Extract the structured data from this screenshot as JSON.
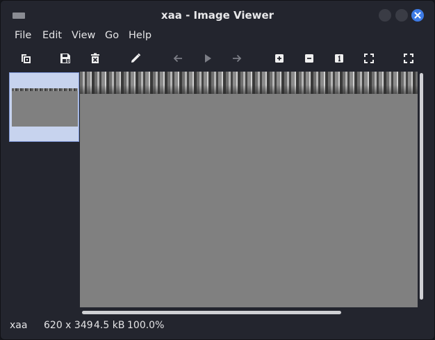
{
  "window": {
    "title": "xaa - Image Viewer",
    "accent_color": "#3d7be6",
    "window_menu_icon": "window-menu-icon",
    "controls": [
      "minimize-button",
      "maximize-button",
      "close-button"
    ]
  },
  "menubar": {
    "items": [
      {
        "label": "File"
      },
      {
        "label": "Edit"
      },
      {
        "label": "View"
      },
      {
        "label": "Go"
      },
      {
        "label": "Help"
      }
    ]
  },
  "toolbar": {
    "buttons": [
      {
        "icon": "open-file-icon",
        "enabled": true
      },
      {
        "icon": "save-icon",
        "enabled": true
      },
      {
        "icon": "delete-icon",
        "enabled": true
      },
      {
        "icon": "edit-pencil-icon",
        "enabled": true
      },
      {
        "icon": "previous-arrow-icon",
        "enabled": false
      },
      {
        "icon": "play-slideshow-icon",
        "enabled": false
      },
      {
        "icon": "next-arrow-icon",
        "enabled": false
      },
      {
        "icon": "zoom-in-icon",
        "enabled": true
      },
      {
        "icon": "zoom-out-icon",
        "enabled": true
      },
      {
        "icon": "zoom-original-icon",
        "enabled": true
      },
      {
        "icon": "zoom-fit-icon",
        "enabled": true
      },
      {
        "icon": "fullscreen-icon",
        "enabled": true
      }
    ]
  },
  "thumbnails": {
    "selected_color": "#c7d3ee"
  },
  "status": {
    "name": "xaa",
    "dimensions": "620 x 349",
    "size": "4.5 kB",
    "zoom": "100.0%"
  }
}
